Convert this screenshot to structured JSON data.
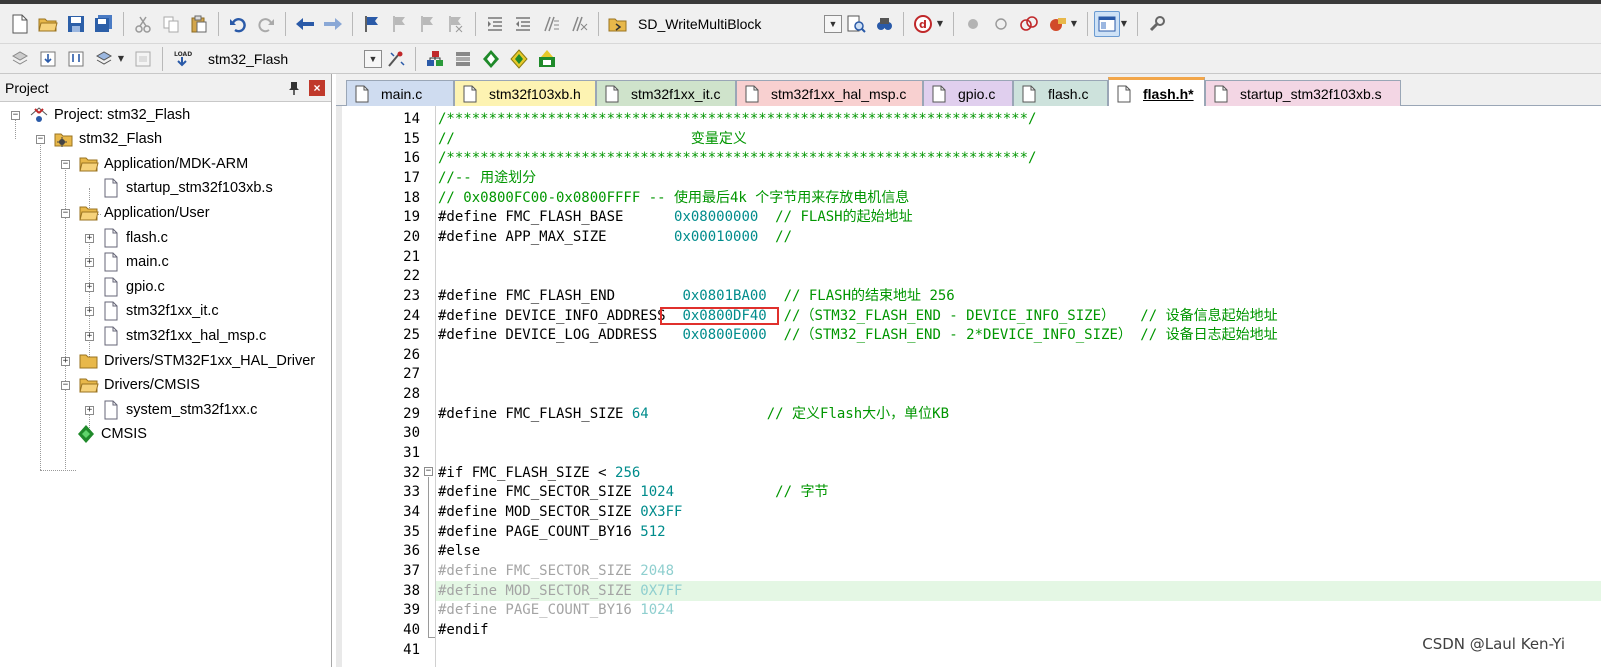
{
  "toolbar1": {
    "target_combo": "SD_WriteMultiBlock"
  },
  "toolbar2": {
    "project_combo": "stm32_Flash"
  },
  "project_panel": {
    "title": "Project",
    "pin": "ᵒ",
    "close": "x",
    "tree": [
      {
        "label": "Project: stm32_Flash",
        "level": 0,
        "kind": "project"
      },
      {
        "label": "stm32_Flash",
        "level": 1,
        "kind": "target"
      },
      {
        "label": "Application/MDK-ARM",
        "level": 2,
        "kind": "folder"
      },
      {
        "label": "startup_stm32f103xb.s",
        "level": 3,
        "kind": "file"
      },
      {
        "label": "Application/User",
        "level": 2,
        "kind": "folder"
      },
      {
        "label": "flash.c",
        "level": 3,
        "kind": "file"
      },
      {
        "label": "main.c",
        "level": 3,
        "kind": "file"
      },
      {
        "label": "gpio.c",
        "level": 3,
        "kind": "file"
      },
      {
        "label": "stm32f1xx_it.c",
        "level": 3,
        "kind": "file"
      },
      {
        "label": "stm32f1xx_hal_msp.c",
        "level": 3,
        "kind": "file"
      },
      {
        "label": "Drivers/STM32F1xx_HAL_Driver",
        "level": 2,
        "kind": "folder"
      },
      {
        "label": "Drivers/CMSIS",
        "level": 2,
        "kind": "folder"
      },
      {
        "label": "system_stm32f1xx.c",
        "level": 3,
        "kind": "file"
      },
      {
        "label": "CMSIS",
        "level": 2,
        "kind": "component"
      }
    ]
  },
  "tabs": [
    {
      "label": "main.c",
      "color": "#cfdcf0"
    },
    {
      "label": "stm32f103xb.h",
      "color": "#fdf3b2"
    },
    {
      "label": "stm32f1xx_it.c",
      "color": "#cfe3cb"
    },
    {
      "label": "stm32f1xx_hal_msp.c",
      "color": "#f8d0d0"
    },
    {
      "label": "gpio.c",
      "color": "#e0cfee"
    },
    {
      "label": "flash.c",
      "color": "#cde2dc"
    },
    {
      "label": "flash.h*",
      "color": "#ffffff",
      "active": true
    },
    {
      "label": "startup_stm32f103xb.s",
      "color": "#f3d6e4"
    }
  ],
  "editor": {
    "lines": [
      {
        "n": "14",
        "text": "/*********************************************************************/",
        "cls": "c-comment"
      },
      {
        "n": "15",
        "text": "//                            变量定义",
        "cls": "c-comment"
      },
      {
        "n": "16",
        "text": "/*********************************************************************/",
        "cls": "c-comment"
      },
      {
        "n": "17",
        "text": "//-- 用途划分",
        "cls": "c-comment"
      },
      {
        "n": "18",
        "text": "// 0x0800FC00-0x0800FFFF -- 使用最后4k 个字节用来存放电机信息",
        "cls": "c-comment"
      },
      {
        "n": "19",
        "pre": "#define FMC_FLASH_BASE      ",
        "num": "0x08000000",
        "cmt": "  // FLASH的起始地址"
      },
      {
        "n": "20",
        "pre": "#define APP_MAX_SIZE        ",
        "num": "0x00010000",
        "cmt": "  //"
      },
      {
        "n": "21",
        "text": ""
      },
      {
        "n": "22",
        "text": ""
      },
      {
        "n": "23",
        "pre": "#define FMC_FLASH_END        ",
        "num": "0x0801BA00",
        "cmt": "  // FLASH的结束地址 256"
      },
      {
        "n": "24",
        "pre": "#define DEVICE_INFO_ADDRESS  ",
        "num": "0x0800DF40",
        "cmt": "  //（STM32_FLASH_END - DEVICE_INFO_SIZE）   // 设备信息起始地址"
      },
      {
        "n": "25",
        "pre": "#define DEVICE_LOG_ADDRESS   ",
        "num": "0x0800E000",
        "cmt": "  //（STM32_FLASH_END - 2*DEVICE_INFO_SIZE） // 设备日志起始地址"
      },
      {
        "n": "26",
        "text": ""
      },
      {
        "n": "27",
        "text": ""
      },
      {
        "n": "28",
        "text": ""
      },
      {
        "n": "29",
        "pre": "#define FMC_FLASH_SIZE ",
        "num": "64",
        "cmt": "              // 定义Flash大小，单位KB"
      },
      {
        "n": "30",
        "text": ""
      },
      {
        "n": "31",
        "text": ""
      },
      {
        "n": "32",
        "pre": "#if FMC_FLASH_SIZE < ",
        "num": "256",
        "cmt": ""
      },
      {
        "n": "33",
        "pre": "#define FMC_SECTOR_SIZE ",
        "num": "1024",
        "cmt": "            // 字节"
      },
      {
        "n": "34",
        "pre": "#define MOD_SECTOR_SIZE ",
        "num": "0X3FF",
        "cmt": ""
      },
      {
        "n": "35",
        "pre": "#define PAGE_COUNT_BY16 ",
        "num": "512",
        "cmt": ""
      },
      {
        "n": "36",
        "pre": "#else",
        "num": "",
        "cmt": ""
      },
      {
        "n": "37",
        "gpre": "#define FMC_SECTOR_SIZE ",
        "gnum": "2048"
      },
      {
        "n": "38",
        "gpre": "#define MOD_SECTOR_SIZE ",
        "gnum": "0X7FF",
        "highlight": true
      },
      {
        "n": "39",
        "gpre": "#define PAGE_COUNT_BY16 ",
        "gnum": "1024"
      },
      {
        "n": "40",
        "pre": "#endif",
        "num": "",
        "cmt": ""
      },
      {
        "n": "41",
        "text": ""
      }
    ]
  },
  "watermark": "CSDN @Laul Ken-Yi",
  "colors": {
    "comment": "#009600",
    "number": "#008c8c",
    "highlight_box": "#e0302c",
    "line_highlight": "#e4f7e4"
  }
}
